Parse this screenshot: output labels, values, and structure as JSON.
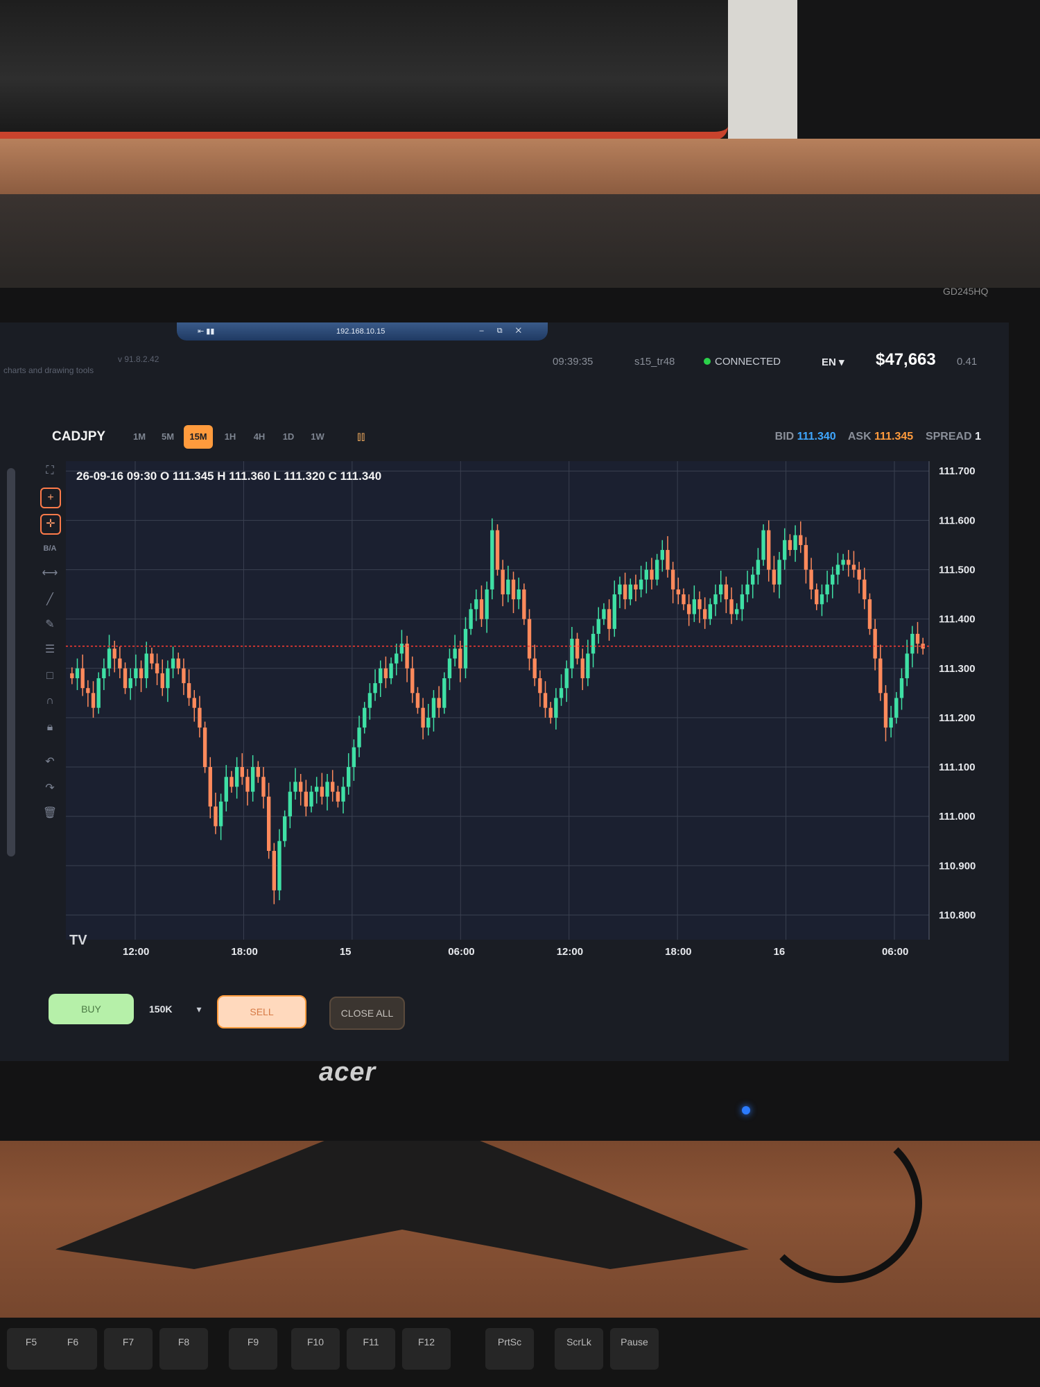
{
  "remote": {
    "ip": "192.168.10.15",
    "left_icons": "⇤ ▮▮",
    "right_icons": "– ⧉ ✕"
  },
  "topbar": {
    "description": "charts and drawing tools",
    "version": "v 91.8.2.42",
    "time": "09:39:35",
    "account": "s15_tr48",
    "status": "CONNECTED",
    "language": "EN",
    "balance": "$47,663",
    "pnl": "0.41"
  },
  "toolbar": {
    "symbol": "CADJPY",
    "timeframes": [
      "1M",
      "5M",
      "15M",
      "1H",
      "4H",
      "1D",
      "1W"
    ],
    "active_timeframe": "15M",
    "bid_label": "BID",
    "bid": "111.340",
    "ask_label": "ASK",
    "ask": "111.345",
    "spread_label": "SPREAD",
    "spread": "1"
  },
  "ohlc_legend": "26-09-16 09:30 O 111.345 H 111.360 L 111.320 C 111.340",
  "tools": [
    "fullscreen-icon",
    "crosshair-icon",
    "crosshair-magnet-icon",
    "bid-ask-icon",
    "measure-icon",
    "trendline-icon",
    "pencil-icon",
    "fib-icon",
    "rectangle-icon",
    "magnet-icon",
    "lock-icon",
    "undo-icon",
    "redo-icon",
    "trash-icon"
  ],
  "bid_ask_label": "B/A",
  "tv_logo": "TV",
  "order": {
    "buy": "BUY",
    "quantity": "150K",
    "sell": "SELL",
    "close_all": "CLOSE ALL"
  },
  "monitor": {
    "brand": "acer",
    "model": "GD245HQ"
  },
  "keyboard": [
    "F5",
    "F6",
    "F7",
    "F8",
    "F9",
    "F10",
    "F11",
    "F12",
    "PrtSc",
    "ScrLk",
    "Pause"
  ],
  "colors": {
    "up": "#3fe0a5",
    "down": "#ff8a5c",
    "price_line": "#ff3b30",
    "grid": "#3a4050",
    "bg": "#1b2030"
  },
  "chart_data": {
    "type": "candlestick",
    "yticks": [
      "111.700",
      "111.600",
      "111.500",
      "111.400",
      "111.300",
      "111.200",
      "111.100",
      "111.000",
      "110.900",
      "110.800"
    ],
    "ylim": [
      110.75,
      111.72
    ],
    "xticks": [
      "12:00",
      "18:00",
      "15",
      "06:00",
      "12:00",
      "18:00",
      "16",
      "06:00"
    ],
    "current_price": 111.345,
    "close": [
      111.28,
      111.3,
      111.26,
      111.25,
      111.22,
      111.28,
      111.3,
      111.34,
      111.32,
      111.3,
      111.26,
      111.28,
      111.3,
      111.28,
      111.33,
      111.31,
      111.29,
      111.26,
      111.3,
      111.32,
      111.3,
      111.27,
      111.24,
      111.22,
      111.18,
      111.1,
      111.02,
      110.98,
      111.03,
      111.08,
      111.06,
      111.1,
      111.08,
      111.05,
      111.1,
      111.08,
      111.04,
      110.93,
      110.85,
      110.95,
      111.0,
      111.05,
      111.07,
      111.05,
      111.02,
      111.05,
      111.06,
      111.04,
      111.07,
      111.05,
      111.03,
      111.06,
      111.1,
      111.14,
      111.18,
      111.22,
      111.25,
      111.27,
      111.3,
      111.28,
      111.31,
      111.33,
      111.35,
      111.3,
      111.25,
      111.22,
      111.18,
      111.2,
      111.24,
      111.22,
      111.28,
      111.32,
      111.34,
      111.3,
      111.38,
      111.42,
      111.44,
      111.4,
      111.46,
      111.58,
      111.5,
      111.45,
      111.48,
      111.44,
      111.46,
      111.4,
      111.32,
      111.28,
      111.25,
      111.22,
      111.2,
      111.24,
      111.26,
      111.3,
      111.36,
      111.32,
      111.28,
      111.33,
      111.37,
      111.4,
      111.42,
      111.38,
      111.45,
      111.47,
      111.44,
      111.47,
      111.46,
      111.48,
      111.5,
      111.48,
      111.52,
      111.54,
      111.5,
      111.46,
      111.45,
      111.43,
      111.41,
      111.44,
      111.42,
      111.4,
      111.43,
      111.45,
      111.47,
      111.44,
      111.41,
      111.42,
      111.45,
      111.47,
      111.49,
      111.52,
      111.58,
      111.5,
      111.47,
      111.52,
      111.56,
      111.54,
      111.57,
      111.55,
      111.5,
      111.46,
      111.43,
      111.45,
      111.47,
      111.49,
      111.51,
      111.52,
      111.51,
      111.5,
      111.48,
      111.44,
      111.38,
      111.32,
      111.25,
      111.18,
      111.2,
      111.24,
      111.28,
      111.33,
      111.37,
      111.35,
      111.34
    ]
  }
}
